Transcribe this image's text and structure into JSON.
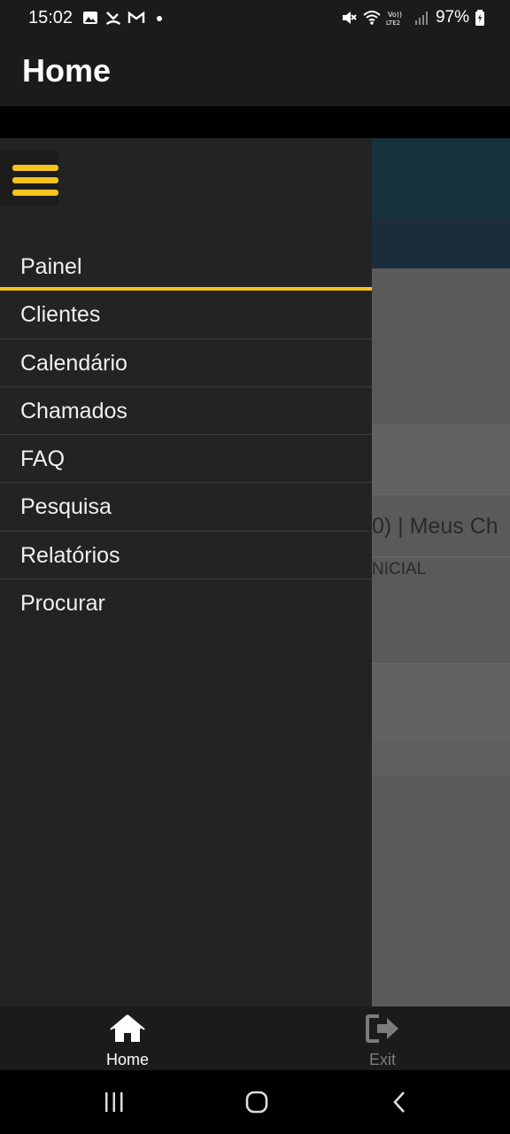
{
  "status_bar": {
    "time": "15:02",
    "battery": "97%",
    "left_icons": [
      "gallery-icon",
      "missed-call-icon",
      "gmail-icon",
      "dot-icon"
    ],
    "right_icons": [
      "mute-icon",
      "wifi-icon",
      "volte-icon",
      "signal-icon",
      "battery-icon"
    ]
  },
  "app_bar": {
    "title": "Home"
  },
  "background": {
    "text_line1": "0)  |  Meus Ch",
    "text_line2": "NICIAL"
  },
  "drawer": {
    "toggle_icon": "hamburger-menu-icon",
    "items": [
      {
        "label": "Painel",
        "active": true
      },
      {
        "label": "Clientes"
      },
      {
        "label": "Calendário"
      },
      {
        "label": "Chamados"
      },
      {
        "label": "FAQ"
      },
      {
        "label": "Pesquisa"
      },
      {
        "label": "Relatórios"
      },
      {
        "label": "Procurar"
      }
    ]
  },
  "bottom_nav": {
    "home": {
      "label": "Home",
      "icon": "home-icon"
    },
    "exit": {
      "label": "Exit",
      "icon": "exit-icon"
    }
  },
  "colors": {
    "accent": "#f6c21c",
    "drawer_bg": "#232323",
    "bar_bg": "#1b1b1b"
  }
}
